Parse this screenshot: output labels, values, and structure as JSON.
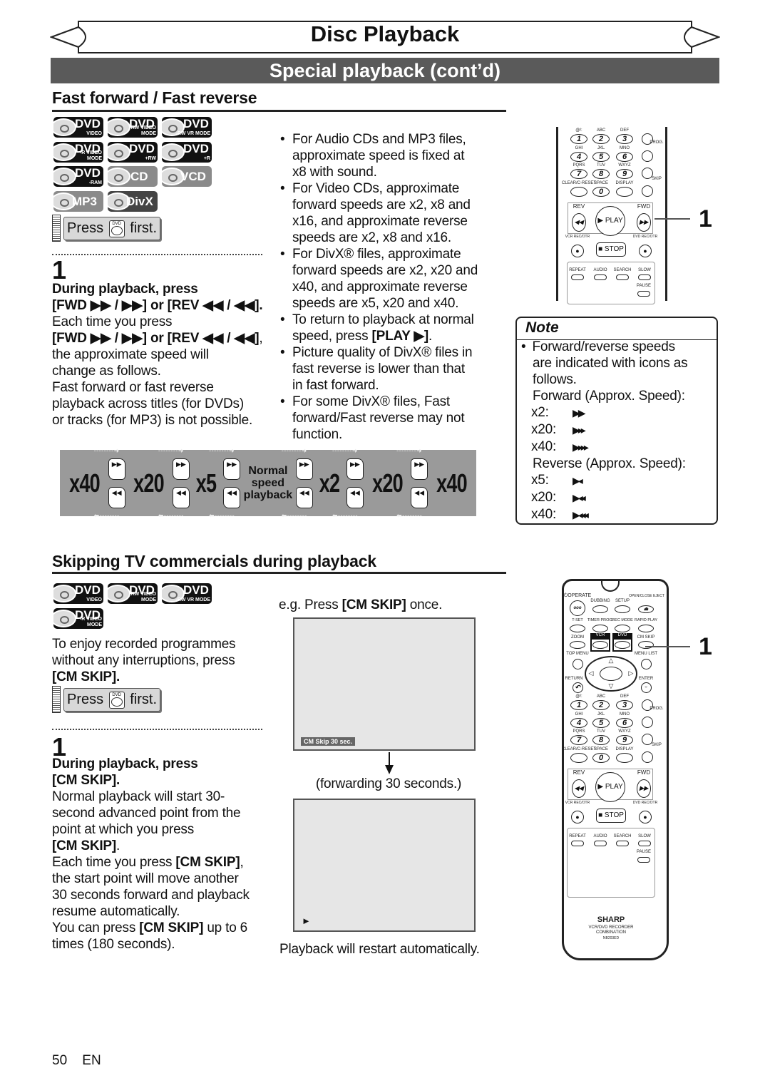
{
  "header": {
    "title": "Disc Playback",
    "subtitle": "Special playback (cont’d)"
  },
  "ff": {
    "heading": "Fast forward / Fast reverse",
    "discs": [
      {
        "main": "DVD",
        "sub": "VIDEO",
        "style": "black"
      },
      {
        "main": "DVD",
        "sub": "-RW VIDEO MODE",
        "style": "black"
      },
      {
        "main": "DVD",
        "sub": "-RW VR MODE",
        "style": "black"
      },
      {
        "main": "DVD",
        "sub": "-R VIDEO MODE",
        "style": "black"
      },
      {
        "main": "DVD",
        "sub": "+RW",
        "style": "black"
      },
      {
        "main": "DVD",
        "sub": "+R",
        "style": "black"
      },
      {
        "main": "DVD",
        "sub": "-RAM",
        "style": "black"
      },
      {
        "main": "CD",
        "sub": "",
        "style": "gray"
      },
      {
        "main": "VCD",
        "sub": "",
        "style": "gray"
      },
      {
        "main": "MP3",
        "sub": "",
        "style": "gray"
      },
      {
        "main": "DivX",
        "sub": "",
        "style": "dark"
      }
    ],
    "press": {
      "before": "Press",
      "key": "DVD",
      "after": "first."
    },
    "step_number": "1",
    "step_lines": [
      [
        [
          "During playback, press",
          1
        ]
      ],
      [
        [
          "[FWD ▶▶ / ▶▶] or [REV ◀◀ / ◀◀].",
          1
        ]
      ],
      [
        [
          "Each time you press",
          0
        ]
      ],
      [
        [
          "[FWD ▶▶ / ▶▶] or [REV ◀◀ / ◀◀]",
          1
        ],
        [
          ",",
          0
        ]
      ],
      [
        [
          "the approximate speed will",
          0
        ]
      ],
      [
        [
          "change as follows.",
          0
        ]
      ],
      [
        [
          "Fast forward or fast reverse",
          0
        ]
      ],
      [
        [
          "playback across titles (for DVDs)",
          0
        ]
      ],
      [
        [
          "or tracks (for MP3) is not possible.",
          0
        ]
      ]
    ],
    "bullets": [
      [
        [
          [
            "For Audio CDs and MP3 files,",
            0
          ]
        ],
        [
          [
            "approximate speed is fixed at",
            0
          ]
        ],
        [
          [
            "x8 with sound.",
            0
          ]
        ]
      ],
      [
        [
          [
            "For Video CDs, approximate",
            0
          ]
        ],
        [
          [
            "forward speeds are x2, x8 and",
            0
          ]
        ],
        [
          [
            "x16, and approximate reverse",
            0
          ]
        ],
        [
          [
            "speeds are x2, x8 and x16.",
            0
          ]
        ]
      ],
      [
        [
          [
            "For DivX® files, approximate",
            0
          ]
        ],
        [
          [
            "forward speeds are x2, x20 and",
            0
          ]
        ],
        [
          [
            "x40, and approximate reverse",
            0
          ]
        ],
        [
          [
            "speeds are x5, x20 and x40.",
            0
          ]
        ]
      ],
      [
        [
          [
            "To return to playback at normal",
            0
          ]
        ],
        [
          [
            "speed, press ",
            0
          ],
          [
            "[PLAY ▶]",
            1
          ],
          [
            ".",
            0
          ]
        ]
      ],
      [
        [
          [
            "Picture quality of DivX® files in",
            0
          ]
        ],
        [
          [
            "fast reverse is lower than that",
            0
          ]
        ],
        [
          [
            "in fast forward.",
            0
          ]
        ]
      ],
      [
        [
          [
            "For some DivX® files, Fast",
            0
          ]
        ],
        [
          [
            "forward/Fast reverse may not",
            0
          ]
        ],
        [
          [
            "function.",
            0
          ]
        ]
      ]
    ],
    "bullet_glyph": "•",
    "speed_bar": {
      "labels": [
        "x40",
        "x20",
        "x5",
        "Normal speed playback",
        "x2",
        "x20",
        "x40"
      ],
      "fwd_key": "▶▶",
      "rev_key": "◀◀",
      "arrow_right": "- - - - - - - - ➜",
      "arrow_left": "⬅ - - - - - - - -"
    },
    "callout": "1"
  },
  "note": {
    "title": "Note",
    "intro": [
      "Forward/reverse speeds",
      "are indicated with icons as",
      "follows."
    ],
    "forward_label": "Forward (Approx. Speed):",
    "forward": [
      {
        "speed": "x2:",
        "icon": "▶▶"
      },
      {
        "speed": "x20:",
        "icon": "▶▸▸"
      },
      {
        "speed": "x40:",
        "icon": "▶▸▸▸"
      }
    ],
    "reverse_label": "Reverse (Approx. Speed):",
    "reverse": [
      {
        "speed": "x5:",
        "icon": "▶◂"
      },
      {
        "speed": "x20:",
        "icon": "▶◂◂"
      },
      {
        "speed": "x40:",
        "icon": "▶◂◂◂"
      }
    ]
  },
  "cm": {
    "heading": "Skipping TV commercials during playback",
    "discs": [
      {
        "main": "DVD",
        "sub": "VIDEO",
        "style": "black"
      },
      {
        "main": "DVD",
        "sub": "-RW VIDEO MODE",
        "style": "black"
      },
      {
        "main": "DVD",
        "sub": "-RW VR MODE",
        "style": "black"
      },
      {
        "main": "DVD",
        "sub": "-R VIDEO MODE",
        "style": "black"
      }
    ],
    "intro": [
      [
        [
          "To enjoy recorded programmes",
          0
        ]
      ],
      [
        [
          "without any interruptions, press",
          0
        ]
      ],
      [
        [
          "[CM SKIP].",
          1
        ]
      ]
    ],
    "press": {
      "before": "Press",
      "key": "DVD",
      "after": "first."
    },
    "step_number": "1",
    "step_lines": [
      [
        [
          "During playback, press",
          1
        ]
      ],
      [
        [
          "[CM SKIP].",
          1
        ]
      ],
      [
        [
          "Normal playback will start 30-",
          0
        ]
      ],
      [
        [
          "second advanced point from the",
          0
        ]
      ],
      [
        [
          "point at which you press",
          0
        ]
      ],
      [
        [
          "[CM SKIP]",
          1
        ],
        [
          ".",
          0
        ]
      ],
      [
        [
          "Each time you press ",
          0
        ],
        [
          "[CM SKIP]",
          1
        ],
        [
          ",",
          0
        ]
      ],
      [
        [
          "the start point will move another",
          0
        ]
      ],
      [
        [
          "30 seconds forward and playback",
          0
        ]
      ],
      [
        [
          "resume automatically.",
          0
        ]
      ],
      [
        [
          "You can press ",
          0
        ],
        [
          "[CM SKIP]",
          1
        ],
        [
          " up to 6",
          0
        ]
      ],
      [
        [
          "times (180 seconds).",
          0
        ]
      ]
    ],
    "example": [
      [
        "e.g. Press ",
        0
      ],
      [
        "[CM SKIP]",
        1
      ],
      [
        " once.",
        0
      ]
    ],
    "osd": "CM Skip  30 sec.",
    "forwarding": "(forwarding 30 seconds.)",
    "play_glyph": "►",
    "restart": "Playback will restart automatically.",
    "callout": "1"
  },
  "remote": {
    "letters": [
      "@/:",
      "ABC",
      "DEF",
      "GHI",
      "JKL",
      "MNO",
      "PQRS",
      "TUV",
      "WXYZ",
      "CLEAR/C-RESET",
      "SPACE",
      "DISPLAY"
    ],
    "keys": [
      "1",
      "2",
      "3",
      "4",
      "5",
      "6",
      "7",
      "8",
      "9",
      "",
      "0",
      ""
    ],
    "prog": "PROG.",
    "skip": "SKIP",
    "rev": "REV",
    "fwd": "FWD",
    "play": "▶ PLAY",
    "stop": "■ STOP",
    "vcr_rec": "VCR REC/OTR",
    "dvd_rec": "DVD REC/OTR",
    "bottom": [
      "REPEAT",
      "AUDIO",
      "SEARCH",
      "SLOW"
    ],
    "pause": "PAUSE",
    "top": {
      "operate": "OPERATE",
      "dubbing": "DUBBING",
      "setup": "SETUP",
      "eject": "OPEN/CLOSE EJECT",
      "row2": [
        "T-SET",
        "TIMER PROG.",
        "REC MODE",
        "RAPID PLAY"
      ],
      "zoom": "ZOOM",
      "vcr": "VCR",
      "dvd": "DVD",
      "cm_skip": "CM SKIP",
      "top_menu": "TOP MENU",
      "menu_list": "MENU LIST",
      "return": "RETURN",
      "enter": "ENTER"
    },
    "brand": "SHARP",
    "model_line1": "VCR/DVD RECORDER",
    "model_line2": "COMBINATION",
    "model": "NB203ED"
  },
  "footer": {
    "page": "50",
    "lang": "EN"
  }
}
